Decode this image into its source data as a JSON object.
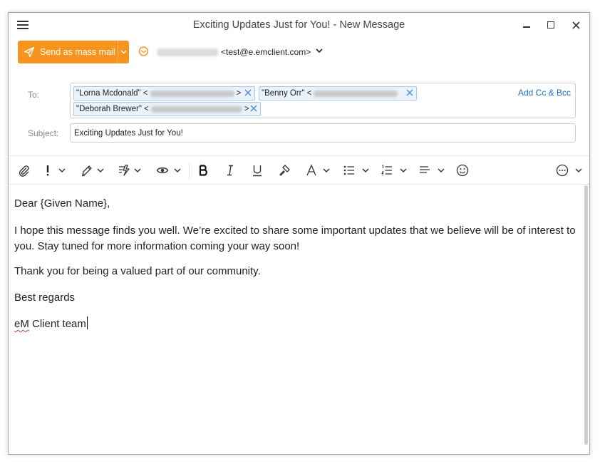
{
  "window": {
    "title": "Exciting Updates Just for You! - New Message"
  },
  "send": {
    "label": "Send as mass mail",
    "from_email": "<test@e.emclient.com>"
  },
  "header": {
    "to_label": "To:",
    "subject_label": "Subject:",
    "add_cc_bcc": "Add Cc & Bcc",
    "recipients": [
      {
        "name": "\"Lorna Mcdonald\" <",
        "close": ">"
      },
      {
        "name": "\"Benny Orr\" <",
        "close": ""
      },
      {
        "name": "\"Deborah Brewer\" <",
        "close": ">"
      }
    ],
    "subject_value": "Exciting Updates Just for You!"
  },
  "toolbar": {
    "items": [
      "paperclip-icon",
      "priority-icon",
      "signature-icon",
      "template-icon",
      "tracking-icon",
      "bold-icon",
      "italic-icon",
      "underline-icon",
      "format-painter-icon",
      "font-color-icon",
      "bulleted-list-icon",
      "numbered-list-icon",
      "align-icon",
      "emoji-icon",
      "more-icon"
    ]
  },
  "body": {
    "greeting": "Dear {Given Name},",
    "paragraph1": "I hope this message finds you well. We’re excited to share some important updates that we believe will be of interest to you. Stay tuned for more information coming your way soon!",
    "paragraph2": "Thank you for being a valued part of our community.",
    "closing": "Best regards",
    "signature_word": "eM",
    "signature_rest": " Client team"
  },
  "colors": {
    "accent": "#f7941d",
    "link": "#1a73c9",
    "chip_bg": "#eaf2fb",
    "chip_border": "#a9c8ea",
    "spell_error": "#e23b3b"
  }
}
